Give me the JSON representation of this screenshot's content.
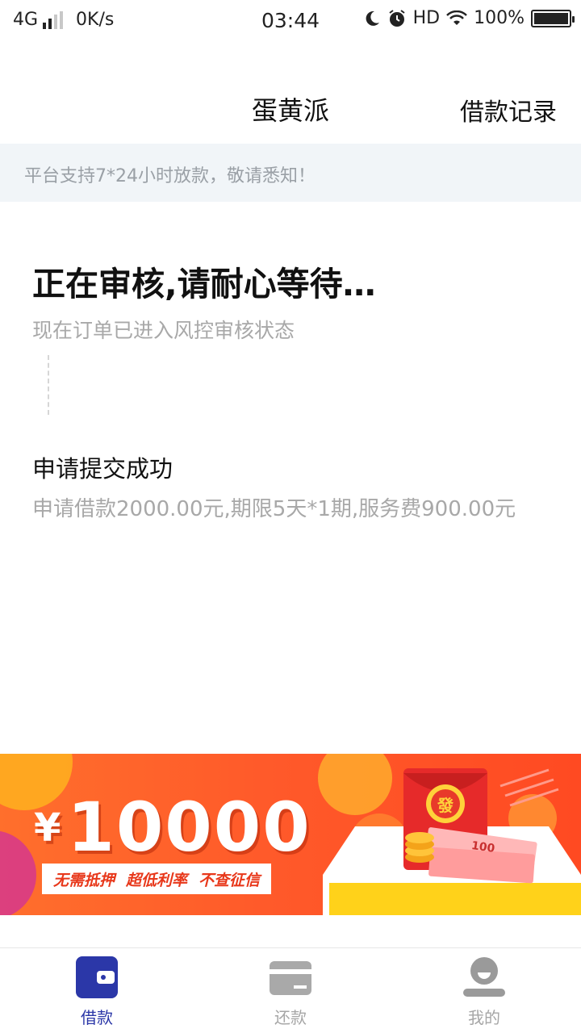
{
  "status_bar": {
    "network": "4G",
    "speed": "0K/s",
    "time": "03:44",
    "hd": "HD",
    "battery": "100%",
    "icons": [
      "signal-icon",
      "moon-icon",
      "alarm-icon",
      "wifi-icon",
      "battery-icon"
    ]
  },
  "header": {
    "title": "蛋黄派",
    "records_label": "借款记录"
  },
  "notice": {
    "text": "平台支持7*24小时放款，敬请悉知！"
  },
  "review": {
    "title": "正在审核,请耐心等待…",
    "subtitle": "现在订单已进入风控审核状态"
  },
  "step": {
    "title": "申请提交成功",
    "description": "申请借款2000.00元,期限5天*1期,服务费900.00元"
  },
  "banner": {
    "currency": "¥",
    "amount": "10000",
    "tags": [
      "无需抵押",
      "超低利率",
      "不查征信"
    ],
    "envelope_char": "發",
    "note_value": "100"
  },
  "tabs": [
    {
      "label": "借款",
      "icon": "wallet-icon",
      "active": true
    },
    {
      "label": "还款",
      "icon": "card-icon",
      "active": false
    },
    {
      "label": "我的",
      "icon": "user-icon",
      "active": false
    }
  ],
  "colors": {
    "accent": "#2b37a8",
    "banner": "#ff5a2a",
    "muted_text": "#a8a8a8",
    "notice_bg": "#f1f5f8"
  }
}
